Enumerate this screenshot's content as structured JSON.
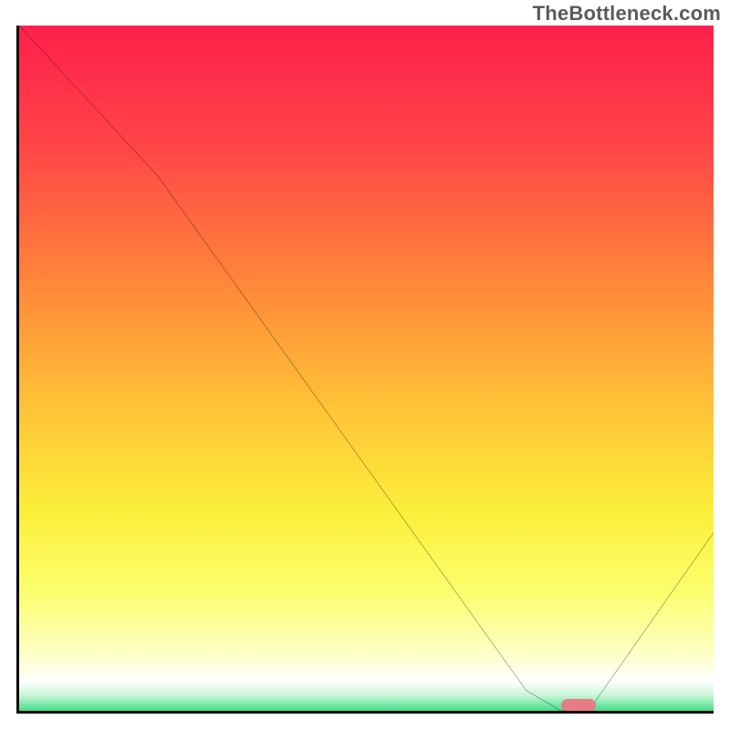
{
  "watermark": "TheBottleneck.com",
  "chart_data": {
    "type": "line",
    "title": "",
    "xlabel": "",
    "ylabel": "",
    "xlim": [
      0,
      100
    ],
    "ylim": [
      0,
      100
    ],
    "grid": false,
    "x": [
      0,
      20,
      73,
      78,
      82,
      100
    ],
    "values": [
      100,
      78,
      3,
      0,
      0,
      26
    ],
    "optimal_marker": {
      "x_start": 78,
      "x_end": 83,
      "y": 0
    },
    "gradient_stops": [
      {
        "pos": 0.0,
        "color": "#ff1f4b"
      },
      {
        "pos": 0.18,
        "color": "#ff4747"
      },
      {
        "pos": 0.38,
        "color": "#ff8a39"
      },
      {
        "pos": 0.55,
        "color": "#ffc337"
      },
      {
        "pos": 0.7,
        "color": "#fcef3a"
      },
      {
        "pos": 0.82,
        "color": "#fbff70"
      },
      {
        "pos": 0.9,
        "color": "#fdffc0"
      },
      {
        "pos": 0.945,
        "color": "#ffffff"
      },
      {
        "pos": 0.965,
        "color": "#c7f6d6"
      },
      {
        "pos": 0.985,
        "color": "#4de08e"
      },
      {
        "pos": 1.0,
        "color": "#0dbf6b"
      }
    ]
  }
}
